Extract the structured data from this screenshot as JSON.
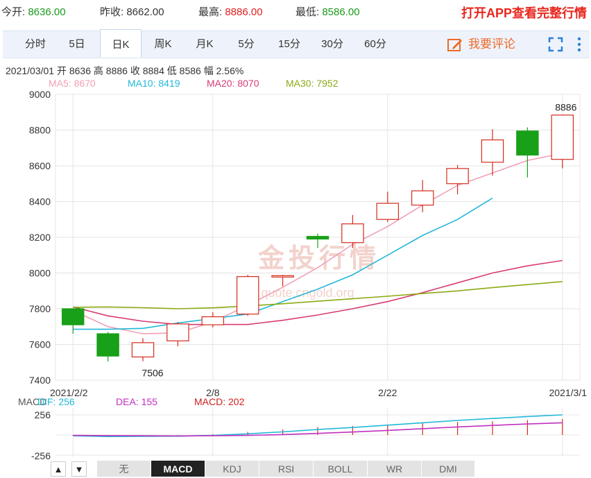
{
  "quote": {
    "open_label": "今开:",
    "open_value": "8636.00",
    "prev_close_label": "昨收:",
    "prev_close_value": "8662.00",
    "high_label": "最高:",
    "high_value": "8886.00",
    "low_label": "最低:",
    "low_value": "8586.00",
    "promo": "打开APP查看完整行情"
  },
  "tabs": [
    "分时",
    "5日",
    "日K",
    "周K",
    "月K",
    "5分",
    "15分",
    "30分",
    "60分"
  ],
  "active_tab": "日K",
  "comment_label": "我要评论",
  "info": {
    "date": "2021/03/01",
    "open_label": "开",
    "open": "8636",
    "high_label": "高",
    "high": "8886",
    "close_label": "收",
    "close": "8884",
    "low_label": "低",
    "low": "8586",
    "amp_label": "幅",
    "amp": "2.56%"
  },
  "ma": [
    {
      "text": "MA5: 8670",
      "color": "#f0a0b6"
    },
    {
      "text": "MA10: 8419",
      "color": "#22b8d8"
    },
    {
      "text": "MA20: 8070",
      "color": "#d83a76"
    },
    {
      "text": "MA30: 7952",
      "color": "#8aaa14"
    }
  ],
  "macd_labels": [
    {
      "text": "MACD",
      "color": "#555555"
    },
    {
      "text": "DIF: 256",
      "color": "#22b8d8"
    },
    {
      "text": "DEA: 155",
      "color": "#c030c0"
    },
    {
      "text": "MACD: 202",
      "color": "#d02020"
    }
  ],
  "watermark": {
    "cn": "金投行情",
    "en": "Au quote.cngold.org"
  },
  "indicator_tabs": [
    "无",
    "MACD",
    "KDJ",
    "RSI",
    "BOLL",
    "WR",
    "DMI"
  ],
  "active_indicator": "MACD",
  "colors": {
    "up": "#d42a1c",
    "down": "#18a018",
    "grid": "#e4e4e4"
  },
  "chart_data": {
    "type": "candlestick",
    "ylim": [
      7400,
      9000
    ],
    "yticks": [
      7400,
      7600,
      7800,
      8000,
      8200,
      8400,
      8600,
      8800,
      9000
    ],
    "x_tick_labels": [
      {
        "index": 0,
        "text": "2021/2/2"
      },
      {
        "index": 4,
        "text": "2/8"
      },
      {
        "index": 9,
        "text": "2/22"
      },
      {
        "index": 14,
        "text": "2021/3/1"
      }
    ],
    "candles": [
      {
        "open": 7800,
        "close": 7710,
        "high": 7800,
        "low": 7660
      },
      {
        "open": 7660,
        "close": 7535,
        "high": 7670,
        "low": 7505
      },
      {
        "open": 7530,
        "close": 7610,
        "high": 7635,
        "low": 7506
      },
      {
        "open": 7620,
        "close": 7715,
        "high": 7725,
        "low": 7590
      },
      {
        "open": 7710,
        "close": 7755,
        "high": 7780,
        "low": 7695
      },
      {
        "open": 7770,
        "close": 7980,
        "high": 7990,
        "low": 7760
      },
      {
        "open": 7980,
        "close": 7985,
        "high": 7990,
        "low": 7925
      },
      {
        "open": 8205,
        "close": 8190,
        "high": 8220,
        "low": 8140
      },
      {
        "open": 8170,
        "close": 8275,
        "high": 8325,
        "low": 8140
      },
      {
        "open": 8300,
        "close": 8390,
        "high": 8455,
        "low": 8285
      },
      {
        "open": 8380,
        "close": 8460,
        "high": 8520,
        "low": 8340
      },
      {
        "open": 8500,
        "close": 8585,
        "high": 8605,
        "low": 8440
      },
      {
        "open": 8620,
        "close": 8745,
        "high": 8805,
        "low": 8545
      },
      {
        "open": 8795,
        "close": 8660,
        "high": 8815,
        "low": 8535
      },
      {
        "open": 8636,
        "close": 8884,
        "high": 8886,
        "low": 8586
      }
    ],
    "annotations": [
      {
        "index": 2,
        "value": 7506,
        "text": "7506"
      },
      {
        "index": 14,
        "value": 8886,
        "text": "8886"
      }
    ],
    "series": [
      {
        "name": "MA5",
        "values": [
          7790,
          7700,
          7660,
          7665,
          7725,
          7820,
          7920,
          8030,
          8160,
          8260,
          8380,
          8490,
          8560,
          8630,
          8670
        ]
      },
      {
        "name": "MA10",
        "values": [
          7685,
          7685,
          7690,
          7720,
          7745,
          7770,
          7840,
          7910,
          7990,
          8100,
          8210,
          8300,
          8419,
          null,
          null
        ]
      },
      {
        "name": "MA20",
        "values": [
          7810,
          7760,
          7730,
          7712,
          7712,
          7712,
          7735,
          7765,
          7800,
          7840,
          7890,
          7945,
          8000,
          8040,
          8070
        ]
      },
      {
        "name": "MA30",
        "values": [
          7808,
          7810,
          7806,
          7800,
          7805,
          7815,
          7828,
          7842,
          7856,
          7870,
          7885,
          7900,
          7918,
          7935,
          7952
        ]
      }
    ],
    "macd": {
      "ylim": [
        -256,
        256
      ],
      "yticks": [
        256,
        -256
      ],
      "dif": [
        -10,
        -20,
        -18,
        -15,
        -5,
        15,
        40,
        70,
        95,
        125,
        155,
        185,
        210,
        235,
        256
      ],
      "dea": [
        -5,
        -8,
        -10,
        -12,
        -10,
        -5,
        5,
        20,
        38,
        58,
        80,
        102,
        122,
        140,
        155
      ],
      "hist": [
        -10,
        -24,
        -16,
        -6,
        10,
        40,
        70,
        100,
        114,
        134,
        150,
        166,
        176,
        190,
        202
      ]
    }
  }
}
